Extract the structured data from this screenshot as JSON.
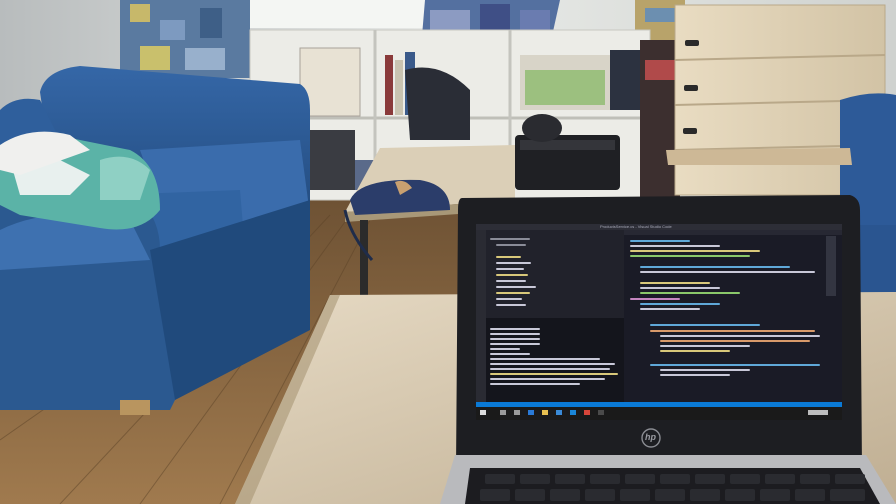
{
  "scene": {
    "description_tag": "photo",
    "colors": {
      "wall": "#e8e8e2",
      "floor": "#8a6a45",
      "sofa": "#2c5b95",
      "desk": "#d8cbb4",
      "laptop_body": "#1d1e22",
      "screen_bg": "#1a1b26"
    }
  },
  "laptop": {
    "brand_logo_text": "hp",
    "editor": {
      "title_bar_text": "ProductsService.cs - Visual Studio Code",
      "status_bar_color": "#0a7ad6",
      "taskbar_color": "#1a1a1a"
    }
  }
}
